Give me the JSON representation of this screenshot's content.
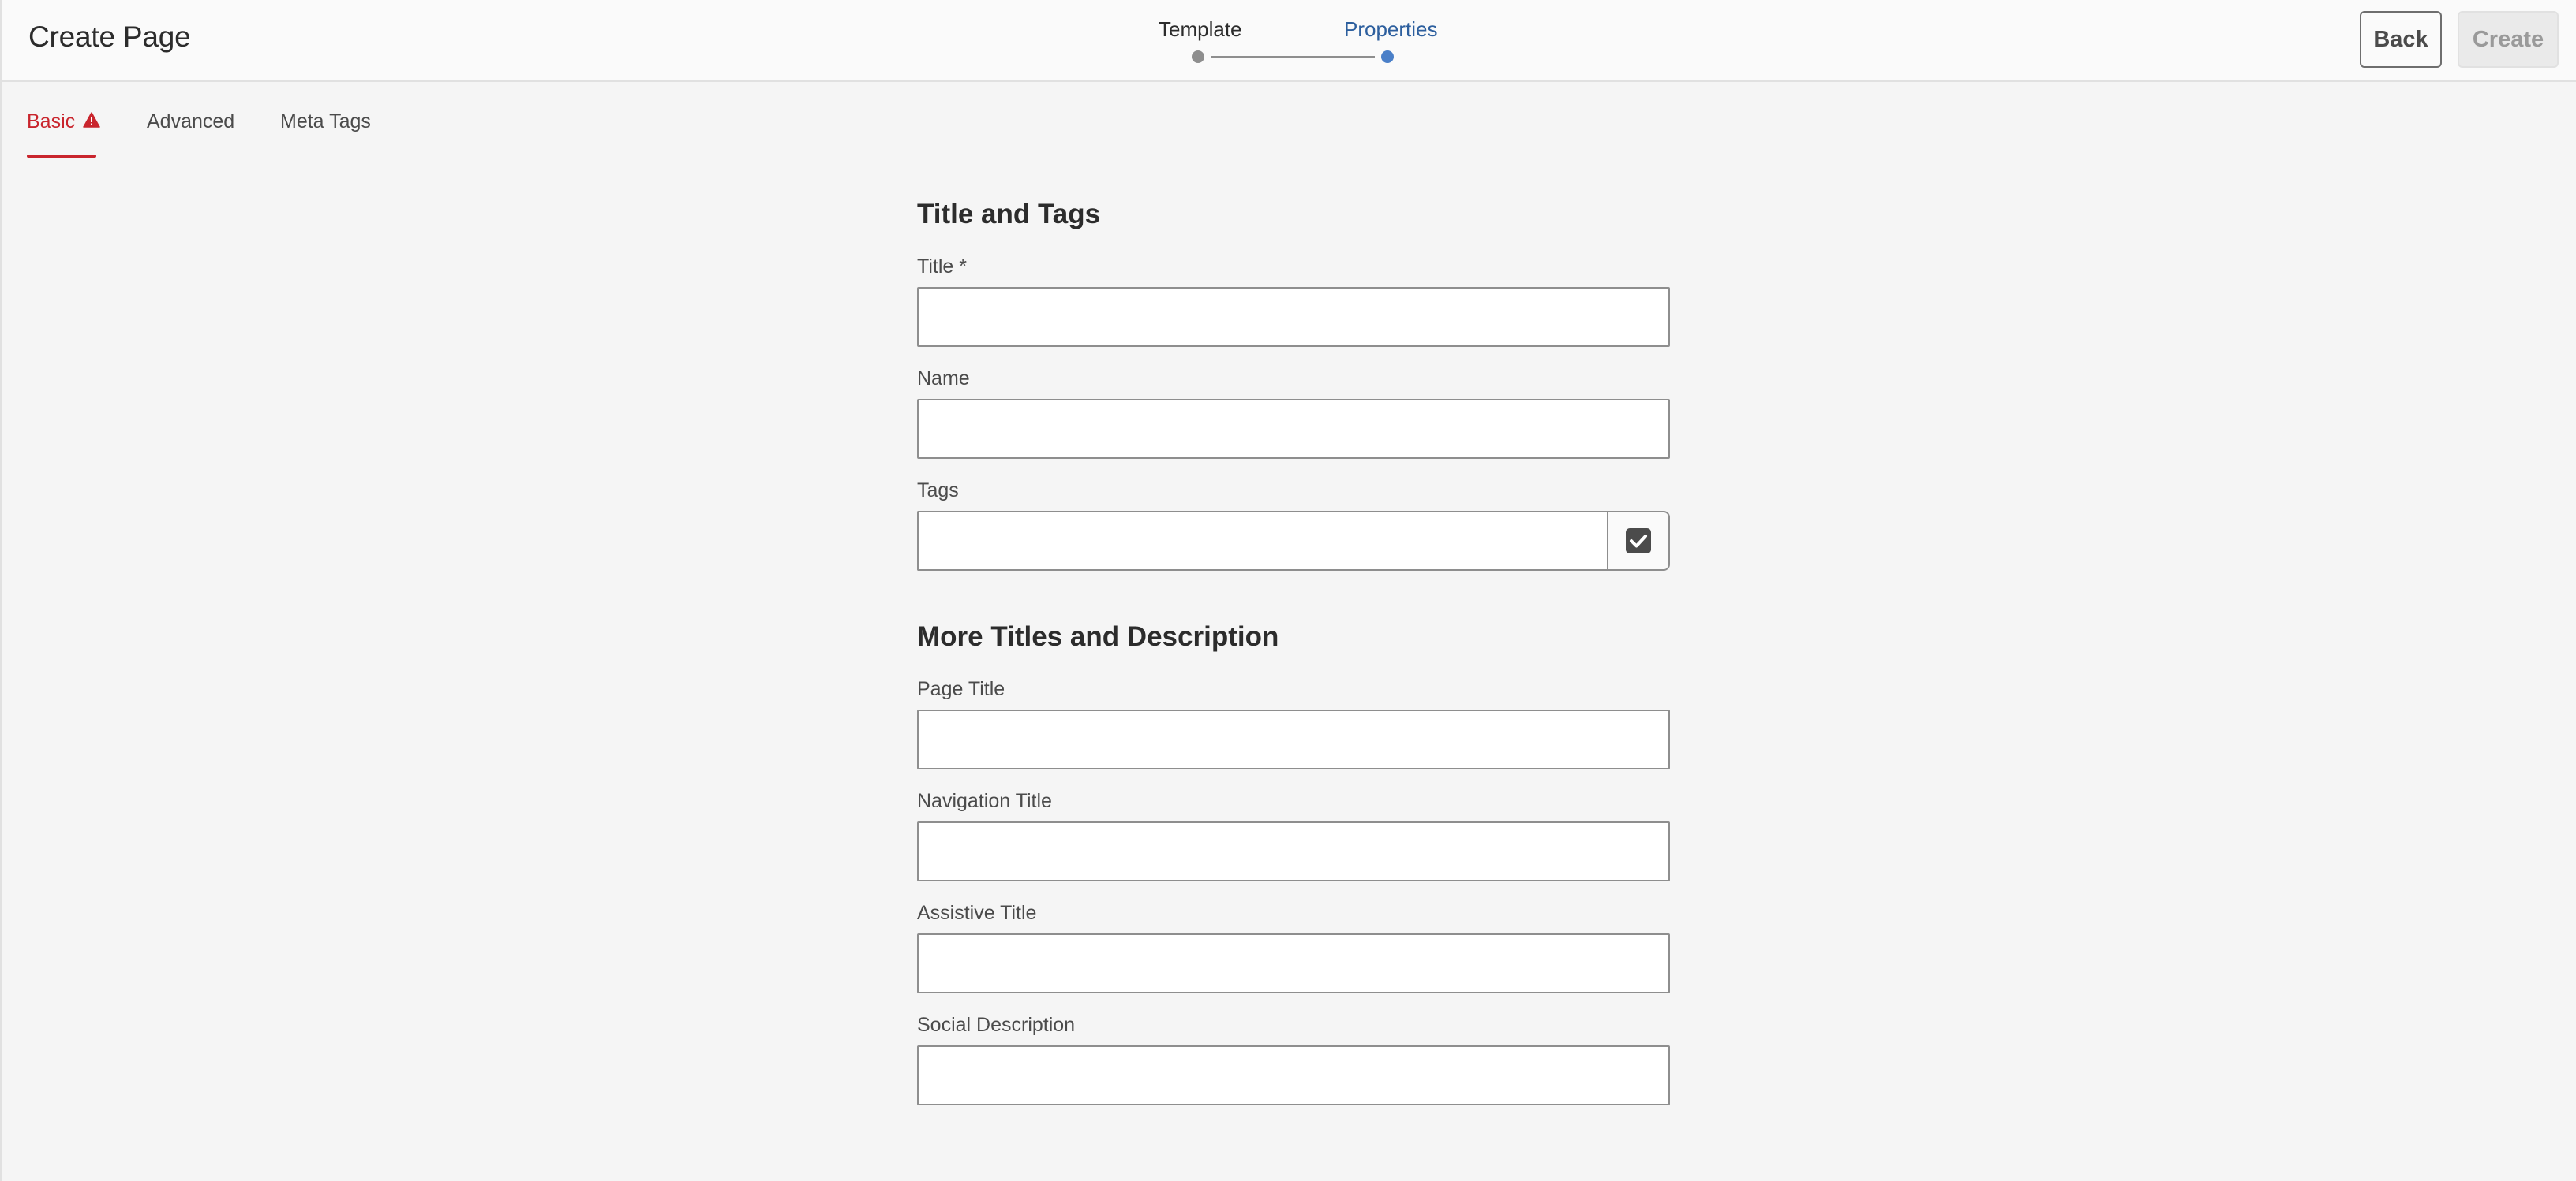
{
  "header": {
    "title": "Create Page",
    "steps": [
      {
        "label": "Template",
        "state": "done"
      },
      {
        "label": "Properties",
        "state": "current"
      }
    ],
    "back_label": "Back",
    "create_label": "Create"
  },
  "tabs": [
    {
      "label": "Basic",
      "active": true,
      "has_error": true
    },
    {
      "label": "Advanced",
      "active": false
    },
    {
      "label": "Meta Tags",
      "active": false
    }
  ],
  "form": {
    "section1_title": "Title and Tags",
    "title_label": "Title *",
    "title_value": "",
    "name_label": "Name",
    "name_value": "",
    "tags_label": "Tags",
    "tags_value": "",
    "section2_title": "More Titles and Description",
    "page_title_label": "Page Title",
    "page_title_value": "",
    "navigation_title_label": "Navigation Title",
    "navigation_title_value": "",
    "assistive_title_label": "Assistive Title",
    "assistive_title_value": "",
    "social_description_label": "Social Description",
    "social_description_value": ""
  },
  "colors": {
    "accent_blue": "#4a7fc8",
    "error_red": "#c9252d",
    "background": "#f5f5f5"
  },
  "icons": {
    "tab_error": "alert-triangle-icon",
    "tags_picker": "checkbox-checked-icon"
  }
}
